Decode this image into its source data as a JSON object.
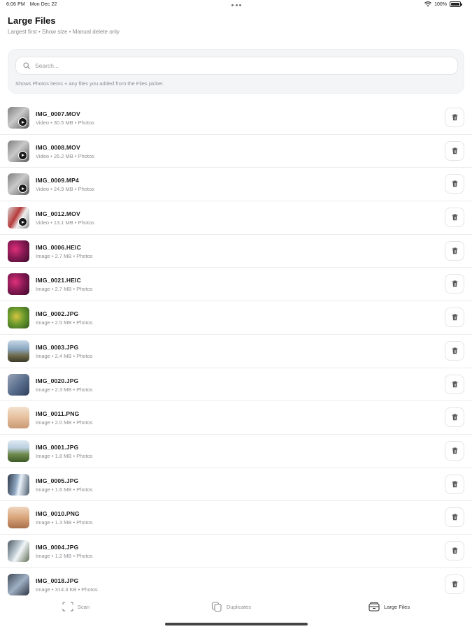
{
  "status_bar": {
    "time": "6:06 PM",
    "date": "Mon Dec 22",
    "battery": "100%"
  },
  "header": {
    "title": "Large Files",
    "subtitle": "Largest first • Show size • Manual delete only"
  },
  "search": {
    "placeholder": "Search...",
    "value": "",
    "hint": "Shows Photos items + any files you added from the Files picker."
  },
  "files": [
    {
      "name": "IMG_0007.MOV",
      "meta": "Video • 30.5 MB • Photos",
      "kind": "video",
      "thumb": "gray"
    },
    {
      "name": "IMG_0008.MOV",
      "meta": "Video • 26.2 MB • Photos",
      "kind": "video",
      "thumb": "gray"
    },
    {
      "name": "IMG_0009.MP4",
      "meta": "Video • 24.9 MB • Photos",
      "kind": "video",
      "thumb": "gray"
    },
    {
      "name": "IMG_0012.MOV",
      "meta": "Video • 13.1 MB • Photos",
      "kind": "video",
      "thumb": "red"
    },
    {
      "name": "IMG_0006.HEIC",
      "meta": "Image • 2.7 MB • Photos",
      "kind": "image",
      "thumb": "magenta"
    },
    {
      "name": "IMG_0021.HEIC",
      "meta": "Image • 2.7 MB • Photos",
      "kind": "image",
      "thumb": "magenta"
    },
    {
      "name": "IMG_0002.JPG",
      "meta": "Image • 2.5 MB • Photos",
      "kind": "image",
      "thumb": "green"
    },
    {
      "name": "IMG_0003.JPG",
      "meta": "Image • 2.4 MB • Photos",
      "kind": "image",
      "thumb": "landscape"
    },
    {
      "name": "IMG_0020.JPG",
      "meta": "Image • 2.3 MB • Photos",
      "kind": "image",
      "thumb": "blue"
    },
    {
      "name": "IMG_0011.PNG",
      "meta": "Image • 2.0 MB • Photos",
      "kind": "image",
      "thumb": "peach"
    },
    {
      "name": "IMG_0001.JPG",
      "meta": "Image • 1.8 MB • Photos",
      "kind": "image",
      "thumb": "hills"
    },
    {
      "name": "IMG_0005.JPG",
      "meta": "Image • 1.6 MB • Photos",
      "kind": "image",
      "thumb": "waterfall"
    },
    {
      "name": "IMG_0010.PNG",
      "meta": "Image • 1.3 MB • Photos",
      "kind": "image",
      "thumb": "portrait"
    },
    {
      "name": "IMG_0004.JPG",
      "meta": "Image • 1.2 MB • Photos",
      "kind": "image",
      "thumb": "falls"
    },
    {
      "name": "IMG_0018.JPG",
      "meta": "Image • 314.3 KB • Photos",
      "kind": "image",
      "thumb": "slate"
    }
  ],
  "tabs": [
    {
      "label": "Scan",
      "icon": "scan-icon",
      "active": false
    },
    {
      "label": "Duplicates",
      "icon": "duplicates-icon",
      "active": false
    },
    {
      "label": "Large Files",
      "icon": "large-files-icon",
      "active": true
    }
  ],
  "colors": {
    "background": "#ffffff",
    "card": "#f4f5f7",
    "secondary_text": "#8e8e93",
    "divider": "#ececee"
  }
}
